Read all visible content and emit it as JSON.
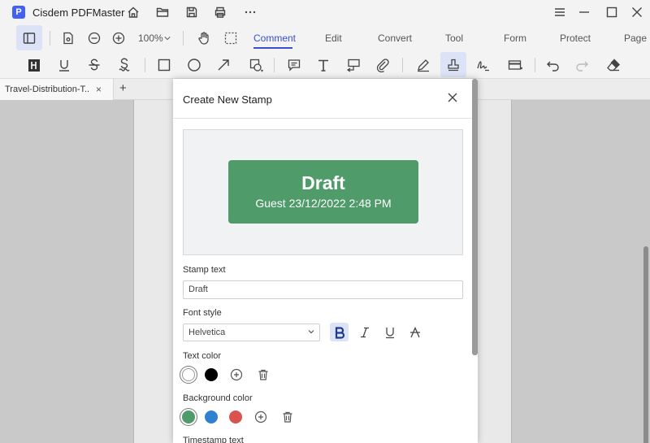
{
  "app": {
    "logo_letter": "P",
    "title": "Cisdem PDFMaster"
  },
  "toolbar": {
    "zoom": "100%",
    "tabs": [
      "Comment",
      "Edit",
      "Convert",
      "Tool",
      "Form",
      "Protect",
      "Page"
    ],
    "active_tab": "Comment"
  },
  "document": {
    "tab_label": "Travel-Distribution-T...",
    "close_glyph": "×",
    "add_glyph": "+"
  },
  "dialog": {
    "title": "Create New Stamp",
    "preview": {
      "title": "Draft",
      "subtitle": "Guest 23/12/2022 2:48 PM",
      "background": "#4f9b6a"
    },
    "stamp_text_label": "Stamp text",
    "stamp_text_value": "Draft",
    "font_style_label": "Font style",
    "font_value": "Helvetica",
    "text_color_label": "Text color",
    "text_colors": [
      "#ffffff",
      "#000000"
    ],
    "background_color_label": "Background color",
    "background_colors": [
      "#4f9b6a",
      "#2f80d0",
      "#d9534f"
    ],
    "timestamp_label": "Timestamp text"
  },
  "colors": {
    "accent": "#3b4fd1",
    "active_bg": "#dde3f7"
  }
}
